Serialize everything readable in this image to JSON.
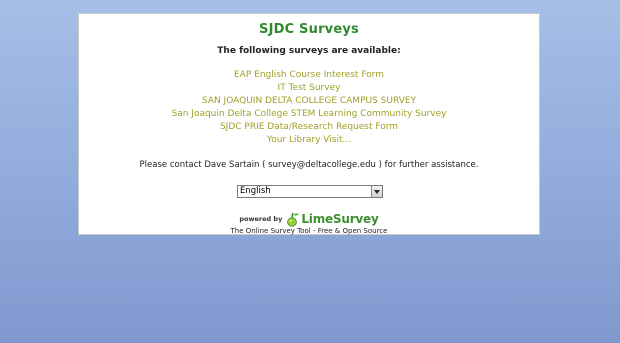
{
  "header": {
    "title": "SJDC Surveys"
  },
  "intro_text": "The following surveys are available:",
  "surveys": [
    "EAP English Course Interest Form",
    "IT Test Survey",
    "SAN JOAQUIN DELTA COLLEGE CAMPUS SURVEY",
    "San Joaquin Delta College STEM Learning Community Survey",
    "SJDC PRIE Data/Research Request Form",
    "Your Library Visit..."
  ],
  "contact_text": "Please contact Dave Sartain ( survey@deltacollege.edu ) for further assistance.",
  "language_select": {
    "selected": "English"
  },
  "footer": {
    "powered_by": "powered by",
    "logo_text": "LimeSurvey",
    "tagline": "The Online Survey Tool - Free & Open Source"
  },
  "colors": {
    "title": "#2f8a2f",
    "link": "#a0a028",
    "background_top": "#a6bfe6",
    "background_bottom": "#7f99cf"
  }
}
